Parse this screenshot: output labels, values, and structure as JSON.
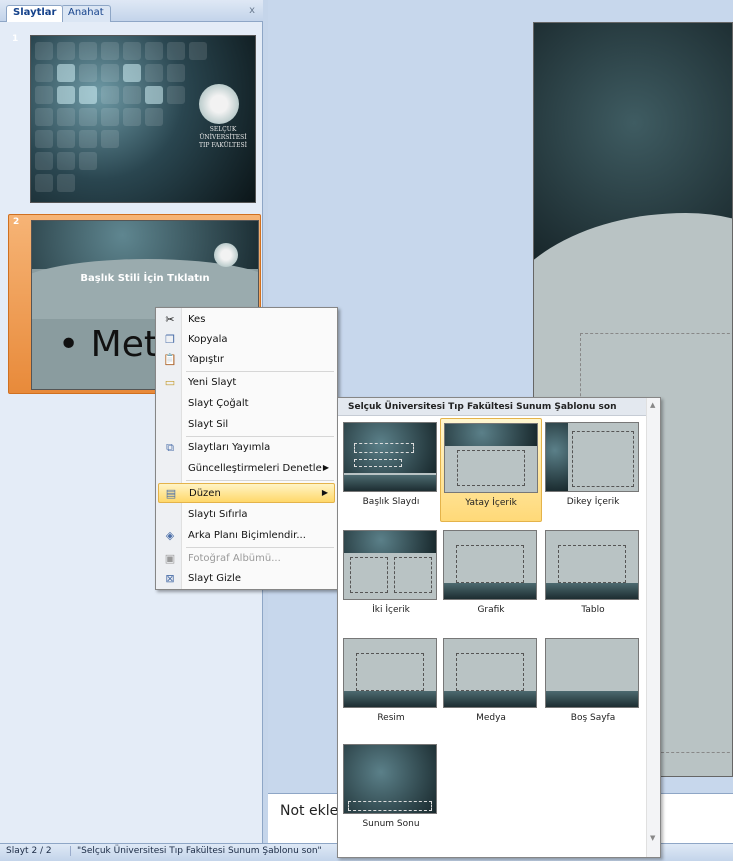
{
  "tabs": {
    "slides": "Slaytlar",
    "outline": "Anahat",
    "close": "x"
  },
  "thumbnails": [
    {
      "number": "1",
      "text_lines": [
        "SELÇUK",
        "ÜNİVERSİTESİ",
        "TIP FAKÜLTESİ"
      ]
    },
    {
      "number": "2",
      "title": "Başlık Stili İçin Tıklatın"
    }
  ],
  "slide": {
    "bullet": "•  Metin"
  },
  "notes": {
    "placeholder": "Not ekler"
  },
  "statusbar": {
    "slide_count": "Slayt 2 / 2",
    "theme": "\"Selçuk Üniversitesi Tıp Fakültesi Sunum Şablonu son\""
  },
  "context_menu": {
    "items": [
      {
        "label": "Kes",
        "icon": "scissors-icon"
      },
      {
        "label": "Kopyala",
        "icon": "copy-icon"
      },
      {
        "label": "Yapıştır",
        "icon": "paste-icon"
      },
      {
        "label": "Yeni Slayt",
        "icon": "new-slide-icon"
      },
      {
        "label": "Slayt Çoğalt",
        "icon": ""
      },
      {
        "label": "Slayt Sil",
        "icon": ""
      },
      {
        "label": "Slaytları Yayımla",
        "icon": "publish-icon"
      },
      {
        "label": "Güncelleştirmeleri Denetle",
        "icon": ""
      },
      {
        "label": "Düzen",
        "icon": "layout-icon"
      },
      {
        "label": "Slaytı Sıfırla",
        "icon": ""
      },
      {
        "label": "Arka Planı Biçimlendir...",
        "icon": "format-background-icon"
      },
      {
        "label": "Fotoğraf Albümü...",
        "icon": "photo-album-icon"
      },
      {
        "label": "Slayt Gizle",
        "icon": "hide-slide-icon"
      }
    ]
  },
  "layout_gallery": {
    "title": "Selçuk Üniversitesi Tıp Fakültesi Sunum Şablonu son",
    "layouts": [
      "Başlık Slaydı",
      "Yatay İçerik",
      "Dikey İçerik",
      "İki İçerik",
      "Grafik",
      "Tablo",
      "Resim",
      "Medya",
      "Boş Sayfa",
      "Sunum Sonu"
    ],
    "selected": "Yatay İçerik"
  }
}
